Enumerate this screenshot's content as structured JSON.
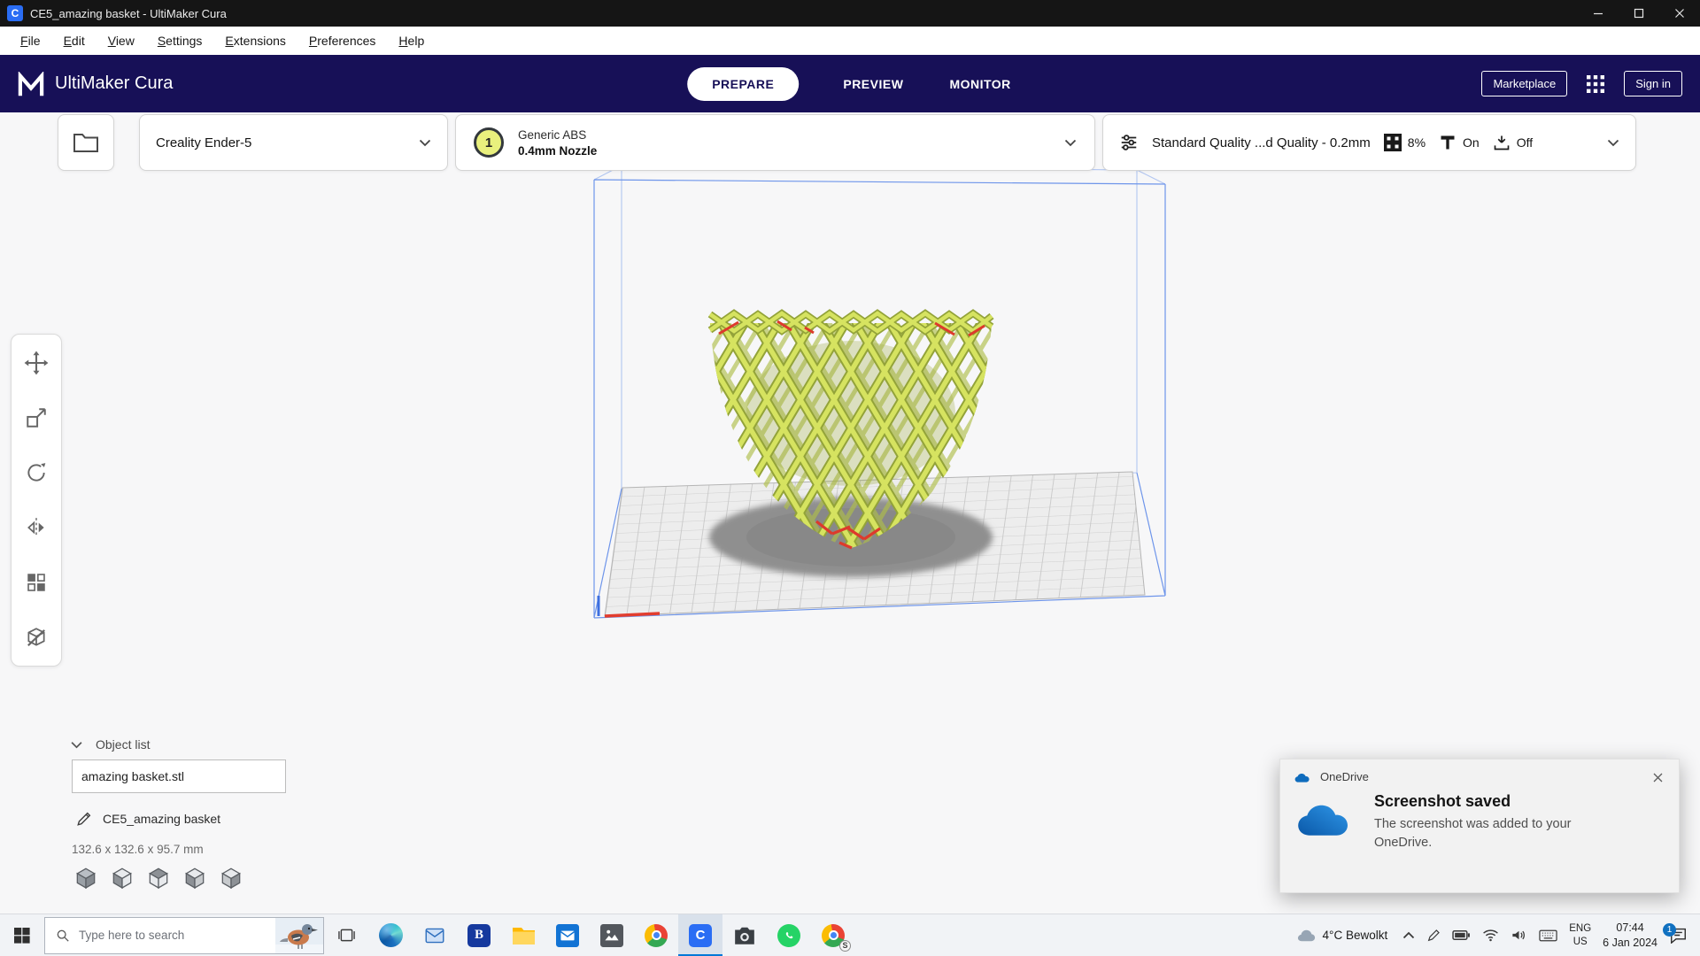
{
  "window": {
    "app_icon_letter": "C",
    "title": "CE5_amazing basket - UltiMaker Cura"
  },
  "menu": {
    "items": [
      {
        "label": "File"
      },
      {
        "label": "Edit"
      },
      {
        "label": "View"
      },
      {
        "label": "Settings"
      },
      {
        "label": "Extensions"
      },
      {
        "label": "Preferences"
      },
      {
        "label": "Help"
      }
    ]
  },
  "header": {
    "brand": "UltiMaker Cura",
    "tabs": [
      {
        "label": "PREPARE",
        "active": true
      },
      {
        "label": "PREVIEW",
        "active": false
      },
      {
        "label": "MONITOR",
        "active": false
      }
    ],
    "marketplace_label": "Marketplace",
    "sign_in_label": "Sign in"
  },
  "config_bar": {
    "printer": {
      "name": "Creality Ender-5"
    },
    "material": {
      "extruder_number": "1",
      "material_name": "Generic ABS",
      "nozzle": "0.4mm Nozzle"
    },
    "print_settings": {
      "profile": "Standard Quality ...d Quality - 0.2mm",
      "infill": "8%",
      "support": "On",
      "adhesion": "Off"
    }
  },
  "tools": [
    {
      "name": "move"
    },
    {
      "name": "scale"
    },
    {
      "name": "rotate"
    },
    {
      "name": "mirror"
    },
    {
      "name": "per-model-settings"
    },
    {
      "name": "support-blocker"
    }
  ],
  "object_panel": {
    "title": "Object list",
    "items": [
      {
        "name": "amazing basket.stl"
      }
    ],
    "job_name": "CE5_amazing basket",
    "dimensions": "132.6 x 132.6 x 95.7 mm"
  },
  "notification": {
    "app_name": "OneDrive",
    "title": "Screenshot saved",
    "body_line1": "The screenshot was added to your",
    "body_line2": "OneDrive."
  },
  "taskbar": {
    "search_placeholder": "Type here to search",
    "apps": [
      {
        "name": "edge"
      },
      {
        "name": "mail"
      },
      {
        "name": "b-app",
        "letter": "B"
      },
      {
        "name": "file-explorer"
      },
      {
        "name": "outlook"
      },
      {
        "name": "photos"
      },
      {
        "name": "chrome"
      },
      {
        "name": "cura",
        "letter": "C",
        "active": true
      },
      {
        "name": "camera"
      },
      {
        "name": "whatsapp"
      },
      {
        "name": "chrome-profile",
        "badge": "S"
      }
    ],
    "tray": {
      "weather": "4°C Bewolkt",
      "language_line1": "ENG",
      "language_line2": "US",
      "time": "07:44",
      "date": "6 Jan 2024",
      "notification_count": "1"
    }
  },
  "colors": {
    "header_bg": "#171057",
    "cura_blue": "#2a6df4",
    "model_lime": "#d6e360",
    "taskbar_active_accent": "#0078d7",
    "whatsapp_green": "#25d366",
    "onedrive_blue": "#0f6cbd"
  }
}
